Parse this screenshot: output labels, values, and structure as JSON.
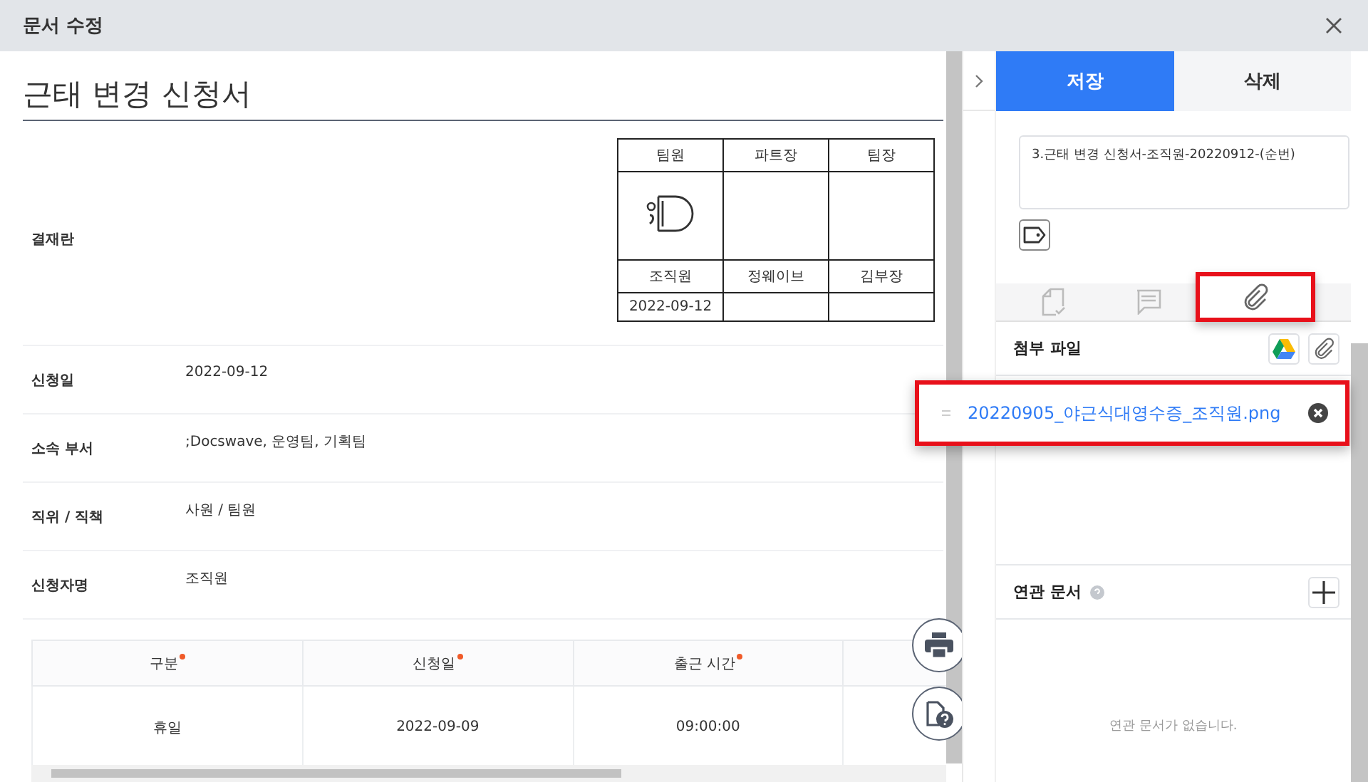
{
  "window": {
    "title": "문서 수정"
  },
  "document": {
    "title": "근태 변경 신청서",
    "approval": {
      "label": "결재란",
      "columns": [
        {
          "role": "팀원",
          "signed": true,
          "name": "조직원",
          "date": "2022-09-12"
        },
        {
          "role": "파트장",
          "signed": false,
          "name": "정웨이브"
        },
        {
          "role": "팀장",
          "signed": false,
          "name": "김부장"
        }
      ]
    },
    "fields": [
      {
        "label": "신청일",
        "value": "2022-09-12"
      },
      {
        "label": "소속 부서",
        "value": ";Docswave, 운영팀, 기획팀"
      },
      {
        "label": "직위 / 직책",
        "value": "사원 / 팀원"
      },
      {
        "label": "신청자명",
        "value": "조직원"
      }
    ],
    "table": {
      "columns": [
        {
          "label": "구분",
          "required": true
        },
        {
          "label": "신청일",
          "required": true
        },
        {
          "label": "출근 시간",
          "required": true
        }
      ],
      "rows": [
        [
          "휴일",
          "2022-09-09",
          "09:00:00"
        ]
      ]
    }
  },
  "side_panel": {
    "buttons": [
      {
        "label": "저장",
        "primary": true
      },
      {
        "label": "삭제",
        "primary": false
      }
    ],
    "doc_name": "3.근태 변경 신청서-조직원-20220912-(순번)",
    "tabs": [
      {
        "kind": "document",
        "selected": false
      },
      {
        "kind": "comment",
        "selected": false
      },
      {
        "kind": "attachment",
        "selected": true
      }
    ],
    "attachments": {
      "title": "첨부 파일",
      "files": [
        {
          "name": "20220905_야근식대영수증_조직원.png",
          "highlighted": true
        }
      ]
    },
    "related": {
      "title": "연관 문서",
      "empty_text": "연관 문서가 없습니다."
    }
  }
}
